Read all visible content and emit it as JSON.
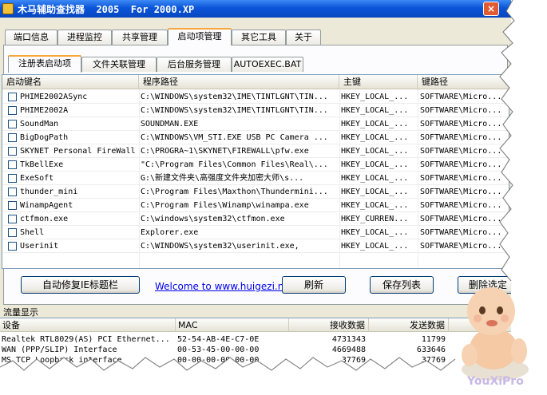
{
  "window": {
    "title": "木马辅助查找器  2005  For 2000.XP",
    "close_glyph": "×"
  },
  "main_tabs": [
    "端口信息",
    "进程监控",
    "共享管理",
    "启动项管理",
    "其它工具",
    "关于"
  ],
  "main_tab_active": 3,
  "sub_tabs": [
    "注册表启动项",
    "文件关联管理",
    "后台服务管理",
    "AUTOEXEC.BAT"
  ],
  "sub_tab_active": 0,
  "startup_list": {
    "columns": [
      "启动键名",
      "程序路径",
      "主键",
      "键路径"
    ],
    "rows": [
      [
        "PHIME2002ASync",
        "C:\\WINDOWS\\system32\\IME\\TINTLGNT\\TIN...",
        "HKEY_LOCAL_...",
        "SOFTWARE\\Micro..."
      ],
      [
        "PHIME2002A",
        "C:\\WINDOWS\\system32\\IME\\TINTLGNT\\TIN...",
        "HKEY_LOCAL_...",
        "SOFTWARE\\Micro..."
      ],
      [
        "SoundMan",
        "SOUNDMAN.EXE",
        "HKEY_LOCAL_...",
        "SOFTWARE\\Micro..."
      ],
      [
        "BigDogPath",
        "C:\\WINDOWS\\VM_STI.EXE USB PC Camera ...",
        "HKEY_LOCAL_...",
        "SOFTWARE\\Micro..."
      ],
      [
        "SKYNET Personal FireWall",
        "C:\\PROGRA~1\\SKYNET\\FIREWALL\\pfw.exe",
        "HKEY_LOCAL_...",
        "SOFTWARE\\Micro..."
      ],
      [
        "TkBellExe",
        "\"C:\\Program Files\\Common Files\\Real\\...",
        "HKEY_LOCAL_...",
        "SOFTWARE\\Micro..."
      ],
      [
        "ExeSoft",
        "G:\\新建文件夹\\高强度文件夹加密大师\\s...",
        "HKEY_LOCAL_...",
        "SOFTWARE\\Micro..."
      ],
      [
        "thunder_mini",
        "C:\\Program Files\\Maxthon\\Thundermini...",
        "HKEY_LOCAL_...",
        "SOFTWARE\\Micro..."
      ],
      [
        "WinampAgent",
        "C:\\Program Files\\Winamp\\winampa.exe",
        "HKEY_LOCAL_...",
        "SOFTWARE\\Micro..."
      ],
      [
        "ctfmon.exe",
        "C:\\windows\\system32\\ctfmon.exe",
        "HKEY_CURREN...",
        "SOFTWARE\\Micro..."
      ],
      [
        "Shell",
        "Explorer.exe",
        "HKEY_LOCAL_...",
        "SOFTWARE\\Micro..."
      ],
      [
        "Userinit",
        "C:\\WINDOWS\\system32\\userinit.exe,",
        "HKEY_LOCAL_...",
        "SOFTWARE\\Micro..."
      ]
    ]
  },
  "buttons": {
    "fix_ie_title": "自动修复IE标题栏",
    "refresh": "刷新",
    "save_list": "保存列表",
    "delete_selected": "删除选定"
  },
  "link_text": "Welcome to www.huigezi.net",
  "traffic": {
    "label": "流量显示",
    "columns": [
      "设备",
      "MAC",
      "接收数据",
      "发送数据"
    ],
    "rows": [
      [
        "Realtek RTL8029(AS) PCI Ethernet...",
        "52-54-AB-4E-C7-0E",
        "4731343",
        "11799"
      ],
      [
        "WAN (PPP/SLIP) Interface",
        "00-53-45-00-00-00",
        "4669488",
        "633646"
      ],
      [
        "MS TCP Loopback interface",
        "00-00-00-00-00-00",
        "37769",
        "37769"
      ]
    ]
  },
  "watermark": "YouXiPro"
}
